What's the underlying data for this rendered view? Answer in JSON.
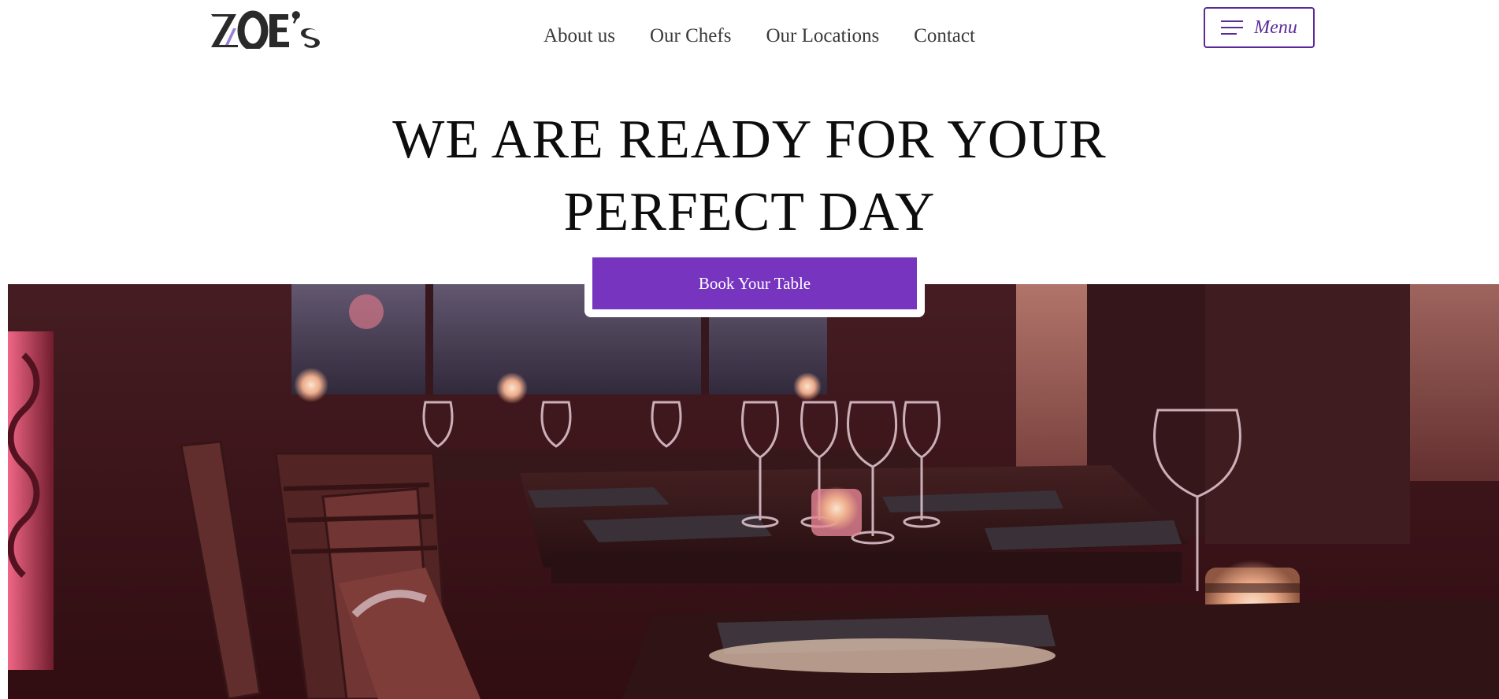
{
  "brand": {
    "logo_text": "ZOE's",
    "accent_color": "#7634bf",
    "menu_border_color": "#5b2a99"
  },
  "nav": {
    "items": [
      {
        "label": "About us"
      },
      {
        "label": "Our Chefs"
      },
      {
        "label": "Our Locations"
      },
      {
        "label": "Contact"
      }
    ]
  },
  "menu_button": {
    "label": "Menu",
    "icon": "hamburger-icon"
  },
  "hero": {
    "title_line_1": "WE ARE READY FOR YOUR",
    "title_line_2": "PERFECT DAY",
    "cta_label": "Book Your Table",
    "image_subject": "restaurant-interior-photo"
  }
}
